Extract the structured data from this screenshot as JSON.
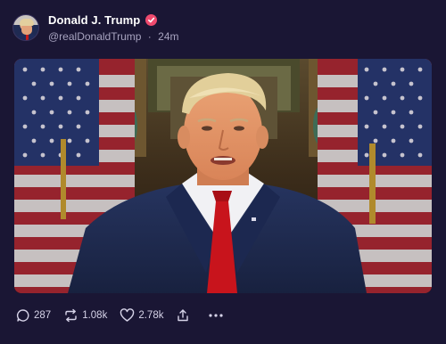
{
  "author": {
    "display_name": "Donald J. Trump",
    "handle": "@realDonaldTrump",
    "separator": "·",
    "time_ago": "24m",
    "verified_icon": "verified-badge-icon"
  },
  "media": {
    "type": "video-still",
    "description_icon": "video-frame"
  },
  "actions": {
    "replies": "287",
    "reposts": "1.08k",
    "likes": "2.78k",
    "share_icon": "share-icon",
    "more_icon": "more-icon"
  },
  "colors": {
    "background": "#1a1634",
    "text_primary": "#ffffff",
    "text_secondary": "#a7a3bf",
    "verified": "#ef4a6e"
  }
}
